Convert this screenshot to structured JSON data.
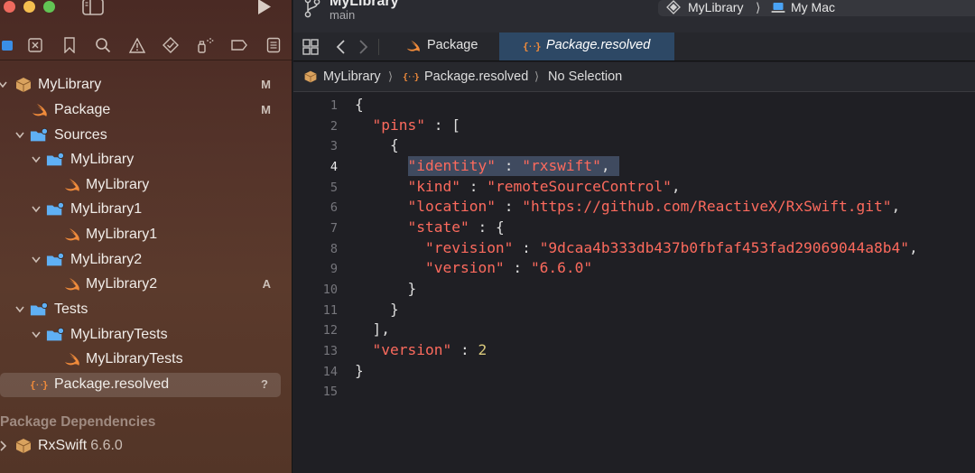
{
  "window": {
    "project_title": "MyLibrary",
    "branch": "main",
    "scheme_target": "MyLibrary",
    "scheme_separator": "⟩",
    "scheme_destination": "My Mac"
  },
  "navigator": {
    "tree": [
      {
        "label": "MyLibrary",
        "badge": "M"
      },
      {
        "label": "Package",
        "badge": "M"
      },
      {
        "label": "Sources",
        "badge": ""
      },
      {
        "label": "MyLibrary",
        "badge": ""
      },
      {
        "label": "MyLibrary",
        "badge": ""
      },
      {
        "label": "MyLibrary1",
        "badge": ""
      },
      {
        "label": "MyLibrary1",
        "badge": ""
      },
      {
        "label": "MyLibrary2",
        "badge": ""
      },
      {
        "label": "MyLibrary2",
        "badge": "A"
      },
      {
        "label": "Tests",
        "badge": ""
      },
      {
        "label": "MyLibraryTests",
        "badge": ""
      },
      {
        "label": "MyLibraryTests",
        "badge": ""
      },
      {
        "label": "Package.resolved",
        "badge": "?"
      }
    ],
    "dependencies_header": "Package Dependencies",
    "dependency": {
      "name": "RxSwift",
      "version": "6.6.0"
    }
  },
  "tabs": [
    {
      "label": "Package"
    },
    {
      "label": "Package.resolved"
    }
  ],
  "jumpbar": {
    "project": "MyLibrary",
    "file": "Package.resolved",
    "selection": "No Selection",
    "separator": "⟩"
  },
  "editor": {
    "current_line": 4,
    "line_numbers": [
      "1",
      "2",
      "3",
      "4",
      "5",
      "6",
      "7",
      "8",
      "9",
      "10",
      "11",
      "12",
      "13",
      "14",
      "15"
    ],
    "text": {
      "pins_key": "\"pins\"",
      "identity_key": "\"identity\"",
      "identity_value": "\"rxswift\"",
      "kind_key": "\"kind\"",
      "kind_value": "\"remoteSourceControl\"",
      "location_key": "\"location\"",
      "location_value": "\"https://github.com/ReactiveX/RxSwift.git\"",
      "state_key": "\"state\"",
      "revision_key": "\"revision\"",
      "revision_value": "\"9dcaa4b333db437b0fbfaf453fad29069044a8b4\"",
      "version_key": "\"version\"",
      "version_value": "\"6.6.0\"",
      "file_version_key": "\"version\"",
      "file_version_value": "2"
    }
  },
  "colors": {
    "sidebar": "#55342a",
    "editor_bg": "#1f1f24",
    "string": "#fc6a5d",
    "number": "#d9c97c",
    "selection_tab": "#2d4865"
  }
}
